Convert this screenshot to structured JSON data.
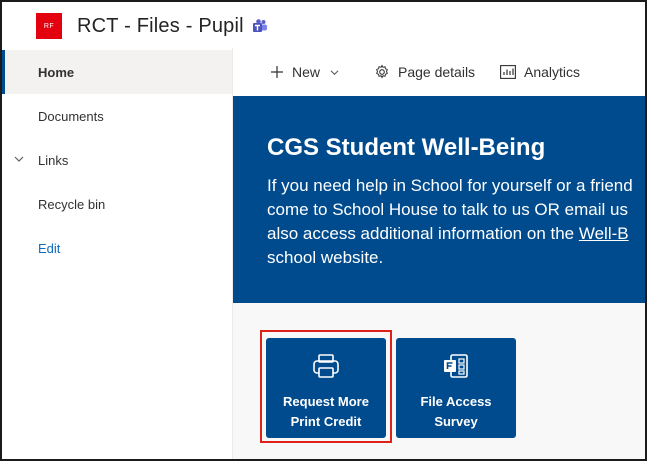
{
  "site": {
    "logo_text": "RF",
    "title": "RCT - Files - Pupil"
  },
  "icons": {
    "teams": "teams-icon",
    "new": "plus-icon",
    "page_details": "gear-icon",
    "analytics": "analytics-icon",
    "links_chevron": "chevron-down-icon",
    "tile1": "printer-icon",
    "tile2": "forms-icon"
  },
  "nav": {
    "items": [
      {
        "label": "Home",
        "selected": true
      },
      {
        "label": "Documents"
      },
      {
        "label": "Links",
        "expandable": true
      },
      {
        "label": "Recycle bin"
      },
      {
        "label": "Edit",
        "link": true
      }
    ]
  },
  "commands": {
    "new": "New",
    "page_details": "Page details",
    "analytics": "Analytics"
  },
  "banner": {
    "title": "CGS Student Well-Being",
    "line1": "If you need help in School for yourself or a friend",
    "line2": "come to School House to talk to us OR email us",
    "line3_prefix": "also access additional information on the ",
    "line3_link": "Well-B",
    "line4": "school website."
  },
  "tiles": [
    {
      "line1": "Request More",
      "line2": "Print Credit",
      "highlighted": true
    },
    {
      "line1": "File Access",
      "line2": "Survey"
    }
  ],
  "colors": {
    "brand": "#004b8d",
    "logo": "#e3000f",
    "highlight": "#e0201b"
  }
}
